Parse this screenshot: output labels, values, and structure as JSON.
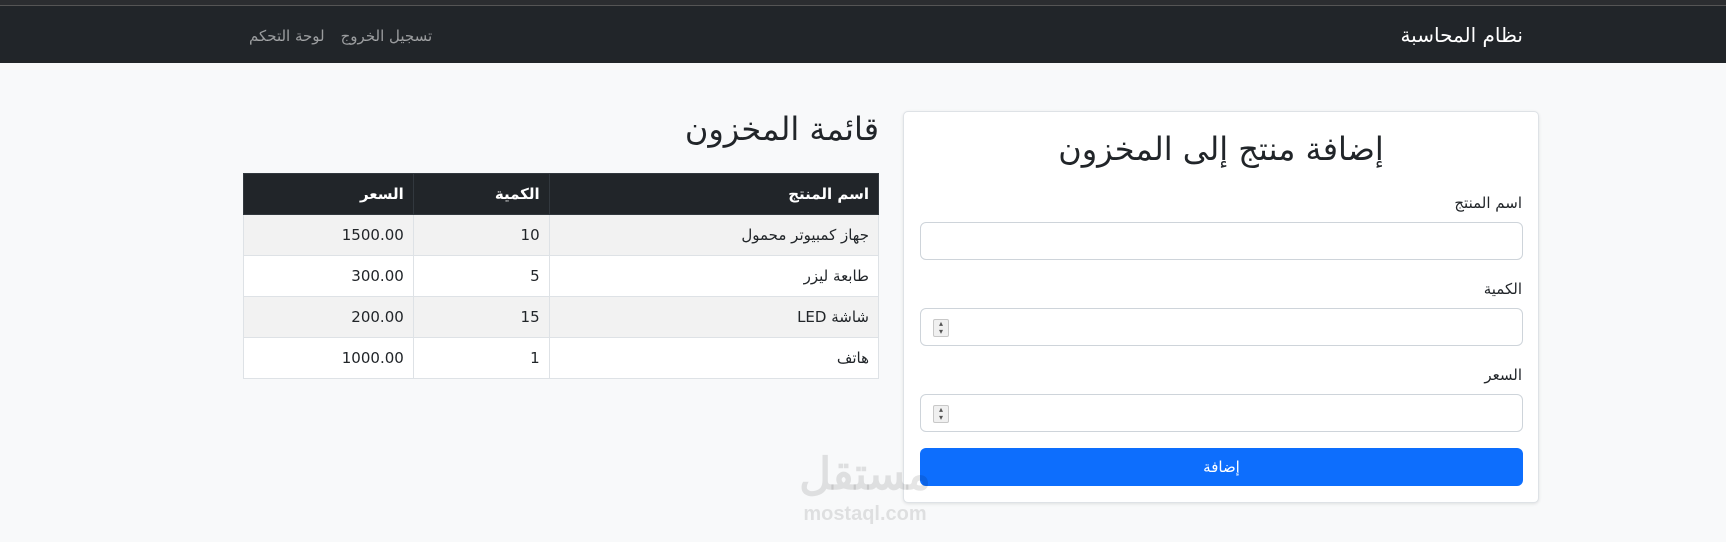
{
  "navbar": {
    "brand": "نظام المحاسبة",
    "links": [
      {
        "label": "لوحة التحكم"
      },
      {
        "label": "تسجيل الخروج"
      }
    ]
  },
  "inventory": {
    "title": "قائمة المخزون",
    "columns": [
      "اسم المنتج",
      "الكمية",
      "السعر"
    ],
    "rows": [
      {
        "name": "جهاز كمبيوتر محمول",
        "qty": "10",
        "price": "1500.00"
      },
      {
        "name": "طابعة ليزر",
        "qty": "5",
        "price": "300.00"
      },
      {
        "name": "شاشة LED",
        "qty": "15",
        "price": "200.00"
      },
      {
        "name": "هاتف",
        "qty": "1",
        "price": "1000.00"
      }
    ]
  },
  "form": {
    "title": "إضافة منتج إلى المخزون",
    "product_name_label": "اسم المنتج",
    "product_name_value": "",
    "quantity_label": "الكمية",
    "quantity_value": "",
    "price_label": "السعر",
    "price_value": "",
    "submit_label": "إضافة"
  },
  "watermark": {
    "arabic": "مستقل",
    "english": "mostaql.com"
  },
  "colors": {
    "navbar_bg": "#212529",
    "primary": "#0d6efd",
    "page_bg": "#f8f9fa"
  }
}
